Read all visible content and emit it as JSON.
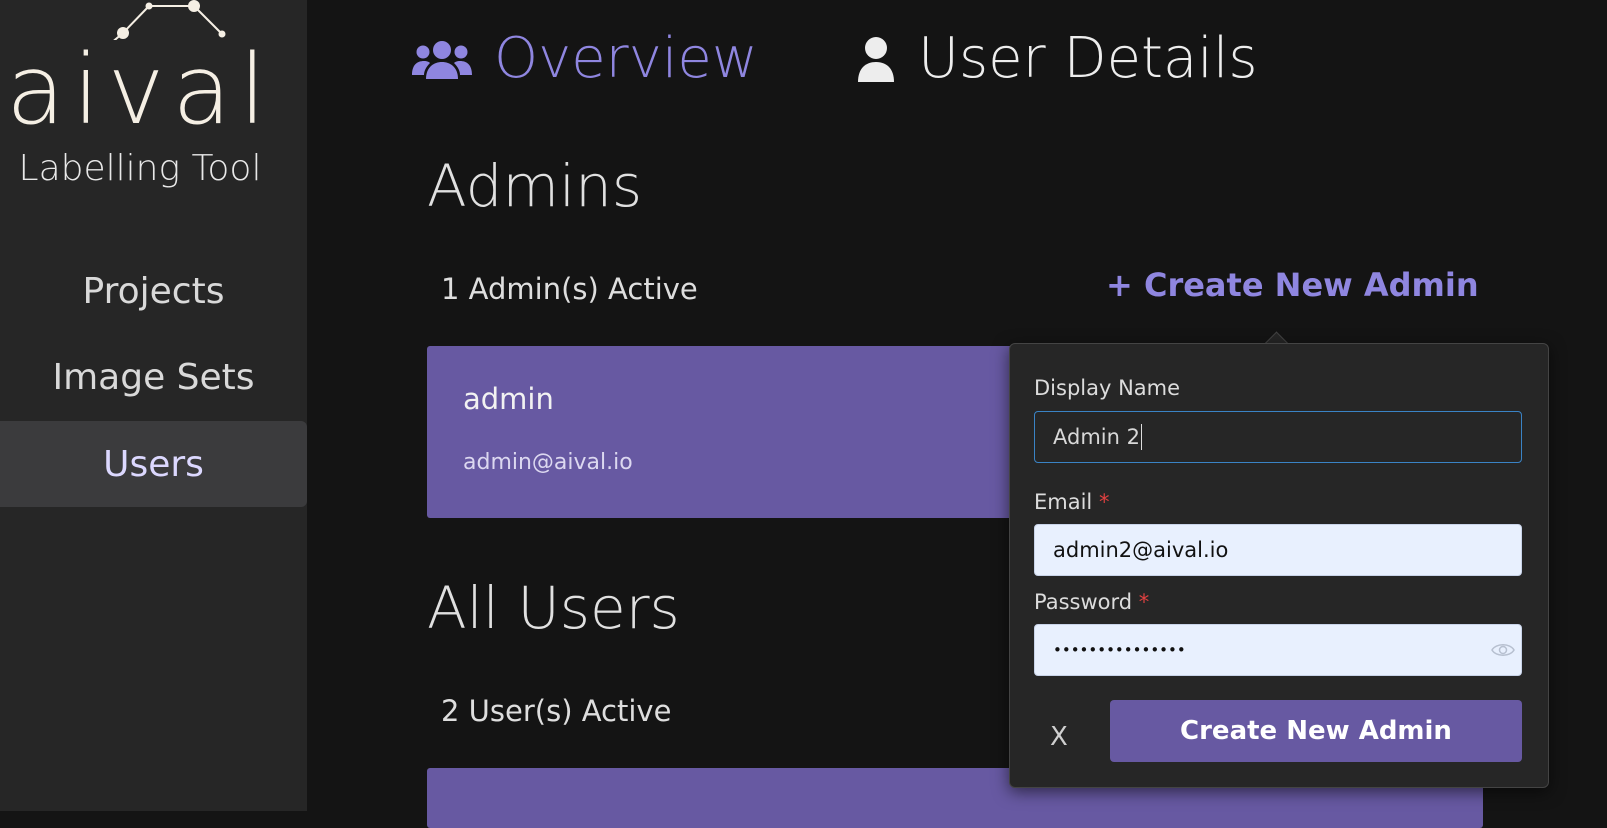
{
  "sidebar": {
    "logo_text": "aival",
    "logo_subtitle": "Labelling Tool",
    "items": [
      {
        "label": "Projects",
        "active": false
      },
      {
        "label": "Image Sets",
        "active": false
      },
      {
        "label": "Users",
        "active": true
      }
    ]
  },
  "topnav": {
    "tabs": [
      {
        "label": "Overview",
        "icon": "users-icon",
        "active": true
      },
      {
        "label": "User Details",
        "icon": "user-icon",
        "active": false
      }
    ]
  },
  "admins": {
    "title": "Admins",
    "count_text": "1 Admin(s) Active",
    "create_link": "+ Create New Admin",
    "list": [
      {
        "name": "admin",
        "email": "admin@aival.io"
      }
    ]
  },
  "all_users": {
    "title": "All Users",
    "count_text": "2 User(s) Active"
  },
  "create_form": {
    "display_name_label": "Display Name",
    "display_name_value": "Admin 2",
    "email_label": "Email",
    "email_value": "admin2@aival.io",
    "password_label": "Password",
    "password_value": "•••••••••••••••",
    "required_marker": "*",
    "close_label": "X",
    "submit_label": "Create New Admin"
  },
  "colors": {
    "accent": "#8f86e0",
    "card": "#6759a2",
    "sidebar": "#262626",
    "background": "#141414"
  }
}
